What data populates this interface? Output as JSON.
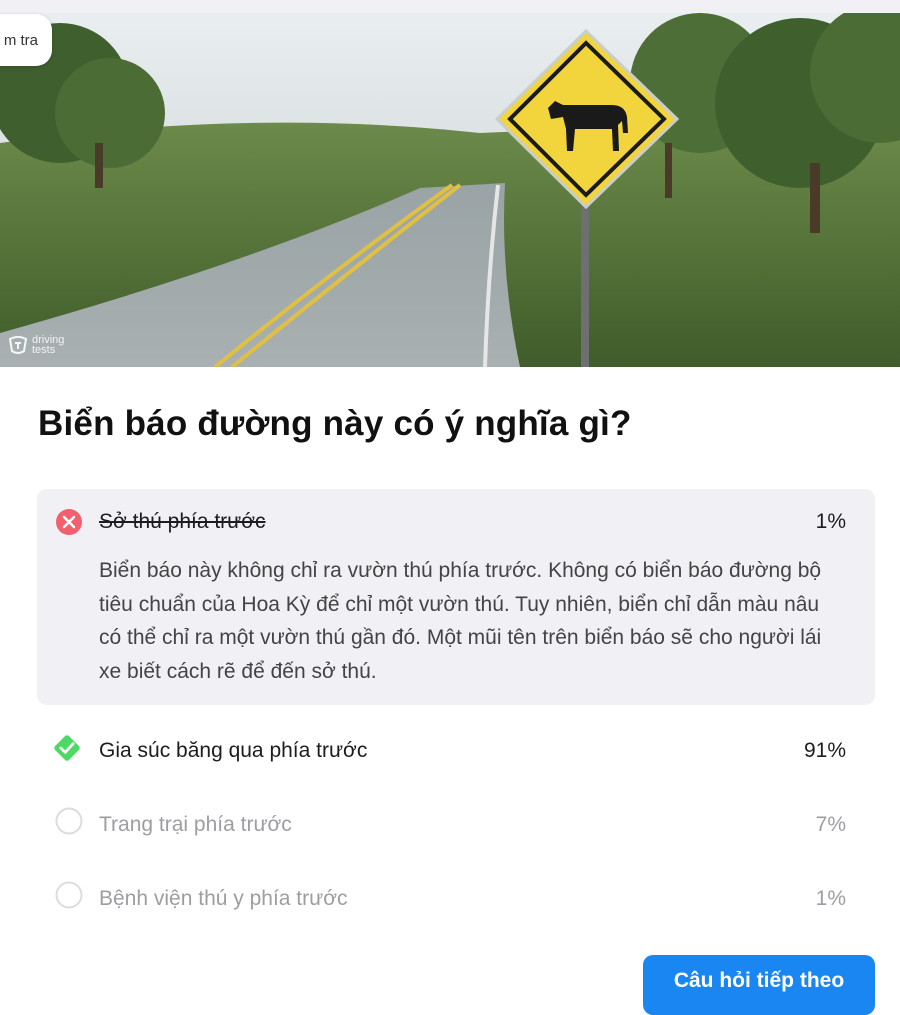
{
  "header": {
    "exam_tab_label": "m tra"
  },
  "hero": {
    "image_subject": "yellow cattle-crossing warning sign beside a rural road",
    "watermark_line1": "driving",
    "watermark_line2": "tests"
  },
  "question": {
    "title": "Biển báo đường này có ý nghĩa gì?"
  },
  "answers": [
    {
      "label": "Sở thú phía trước",
      "percent": "1%",
      "state": "wrong-selected",
      "icon": "close-circle-icon",
      "explanation": "Biển báo này không chỉ ra vườn thú phía trước. Không có biển báo đường bộ tiêu chuẩn của Hoa Kỳ để chỉ một vườn thú. Tuy nhiên, biển chỉ dẫn màu nâu có thể chỉ ra một vườn thú gần đó. Một mũi tên trên biển báo sẽ cho người lái xe biết cách rẽ để đến sở thú."
    },
    {
      "label": "Gia súc băng qua phía trước",
      "percent": "91%",
      "state": "correct",
      "icon": "check-diamond-icon"
    },
    {
      "label": "Trang trại phía trước",
      "percent": "7%",
      "state": "unselected",
      "icon": "empty-circle-icon"
    },
    {
      "label": "Bệnh viện thú y phía trước",
      "percent": "1%",
      "state": "unselected",
      "icon": "empty-circle-icon"
    }
  ],
  "footer": {
    "next_button_label": "Câu hỏi tiếp theo"
  },
  "colors": {
    "wrong": "#f0606e",
    "correct": "#4cd964",
    "button": "#1a86f2",
    "selected_bg": "#f1f0f5"
  }
}
